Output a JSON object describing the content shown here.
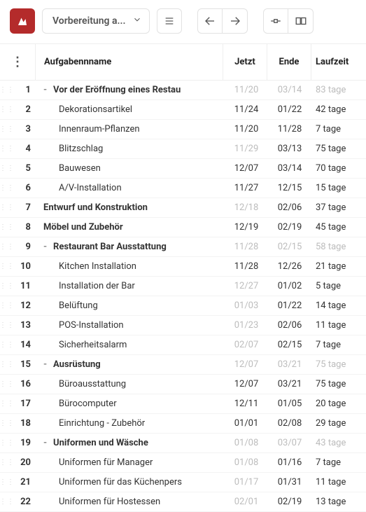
{
  "toolbar": {
    "title": "Vorbereitung a..."
  },
  "columns": {
    "name": "Aufgabennname",
    "jetzt": "Jetzt",
    "ende": "Ende",
    "laufzeit": "Laufzeit"
  },
  "rows": [
    {
      "n": "1",
      "color": "#6c8cff",
      "name": "Vor der Eröffnung eines Restau",
      "parent": true,
      "indent": 1,
      "jetzt": "11/20",
      "ende": "03/14",
      "lauf": "83 tage",
      "mJetzt": true,
      "mEnde": true,
      "mLauf": true
    },
    {
      "n": "2",
      "color": "#f4a24a",
      "name": "Dekorationsartikel",
      "parent": false,
      "indent": 2,
      "jetzt": "11/24",
      "ende": "01/22",
      "lauf": "42 tage"
    },
    {
      "n": "3",
      "color": "#c23b3b",
      "name": "Innenraum-Pflanzen",
      "parent": false,
      "indent": 2,
      "jetzt": "11/20",
      "ende": "11/28",
      "lauf": "7 tage"
    },
    {
      "n": "4",
      "color": "#d8c9ff",
      "name": "Blitzschlag",
      "parent": false,
      "indent": 2,
      "jetzt": "11/29",
      "ende": "03/13",
      "lauf": "75 tage",
      "mJetzt": true
    },
    {
      "n": "5",
      "color": "#f6c6de",
      "name": "Bauwesen",
      "parent": false,
      "indent": 2,
      "jetzt": "12/07",
      "ende": "03/14",
      "lauf": "70 tage"
    },
    {
      "n": "6",
      "color": "#7bb0ff",
      "name": "A/V-Installation",
      "parent": false,
      "indent": 2,
      "jetzt": "11/27",
      "ende": "12/15",
      "lauf": "15 tage"
    },
    {
      "n": "7",
      "color": "#1e56c9",
      "name": "Entwurf und Konstruktion",
      "parent": false,
      "indent": 1,
      "bold": true,
      "jetzt": "12/18",
      "ende": "02/06",
      "lauf": "37 tage",
      "mJetzt": true
    },
    {
      "n": "8",
      "color": "#3a4aa0",
      "name": "Möbel und Zubehör",
      "parent": false,
      "indent": 1,
      "bold": true,
      "jetzt": "12/19",
      "ende": "02/19",
      "lauf": "45 tage"
    },
    {
      "n": "9",
      "color": "#f3e96b",
      "name": "Restaurant Bar Ausstattung",
      "parent": true,
      "indent": 1,
      "jetzt": "11/28",
      "ende": "02/15",
      "lauf": "58 tage",
      "mJetzt": true,
      "mEnde": true,
      "mLauf": true
    },
    {
      "n": "10",
      "color": "#7bb0ff",
      "name": "Kitchen Installation",
      "parent": false,
      "indent": 2,
      "jetzt": "11/28",
      "ende": "12/26",
      "lauf": "21 tage"
    },
    {
      "n": "11",
      "color": "#f3e96b",
      "name": "Installation der Bar",
      "parent": false,
      "indent": 2,
      "jetzt": "12/27",
      "ende": "01/02",
      "lauf": "5 tage",
      "mJetzt": true
    },
    {
      "n": "12",
      "color": "#f3e96b",
      "name": "Belüftung",
      "parent": false,
      "indent": 2,
      "jetzt": "01/03",
      "ende": "01/22",
      "lauf": "14 tage",
      "mJetzt": true
    },
    {
      "n": "13",
      "color": "#f4a24a",
      "name": "POS-Installation",
      "parent": false,
      "indent": 2,
      "jetzt": "01/23",
      "ende": "02/06",
      "lauf": "11 tage",
      "mJetzt": true
    },
    {
      "n": "14",
      "color": "#d95b5b",
      "name": "Sicherheitsalarm",
      "parent": false,
      "indent": 2,
      "jetzt": "02/07",
      "ende": "02/15",
      "lauf": "7 tage",
      "mJetzt": true
    },
    {
      "n": "15",
      "color": "#d95b5b",
      "name": "Ausrüstung",
      "parent": true,
      "indent": 1,
      "jetzt": "12/07",
      "ende": "03/21",
      "lauf": "75 tage",
      "mJetzt": true,
      "mEnde": true,
      "mLauf": true
    },
    {
      "n": "16",
      "color": "#a0a0a0",
      "name": "Büroausstattung",
      "parent": false,
      "indent": 2,
      "jetzt": "12/07",
      "ende": "03/21",
      "lauf": "75 tage"
    },
    {
      "n": "17",
      "color": "#e06b34",
      "name": "Bürocomputer",
      "parent": false,
      "indent": 2,
      "jetzt": "12/11",
      "ende": "01/05",
      "lauf": "20 tage"
    },
    {
      "n": "18",
      "color": "#4aa564",
      "name": "Einrichtung - Zubehör",
      "parent": false,
      "indent": 2,
      "jetzt": "01/01",
      "ende": "02/08",
      "lauf": "29 tage"
    },
    {
      "n": "19",
      "color": "#f4a24a",
      "name": "Uniformen und Wäsche",
      "parent": true,
      "indent": 1,
      "jetzt": "01/08",
      "ende": "03/07",
      "lauf": "43 tage",
      "mJetzt": true,
      "mEnde": true,
      "mLauf": true
    },
    {
      "n": "20",
      "color": "#8fc96f",
      "name": "Uniformen für Manager",
      "parent": false,
      "indent": 2,
      "jetzt": "01/08",
      "ende": "01/16",
      "lauf": "7 tage",
      "mJetzt": true
    },
    {
      "n": "21",
      "color": "#f3e96b",
      "name": "Uniformen für das Küchenpers",
      "parent": false,
      "indent": 2,
      "jetzt": "01/17",
      "ende": "01/31",
      "lauf": "11 tage",
      "mJetzt": true
    },
    {
      "n": "22",
      "color": "#8fc96f",
      "name": "Uniformen für Hostessen",
      "parent": false,
      "indent": 2,
      "jetzt": "02/01",
      "ende": "02/19",
      "lauf": "13 tage",
      "mJetzt": true
    }
  ]
}
